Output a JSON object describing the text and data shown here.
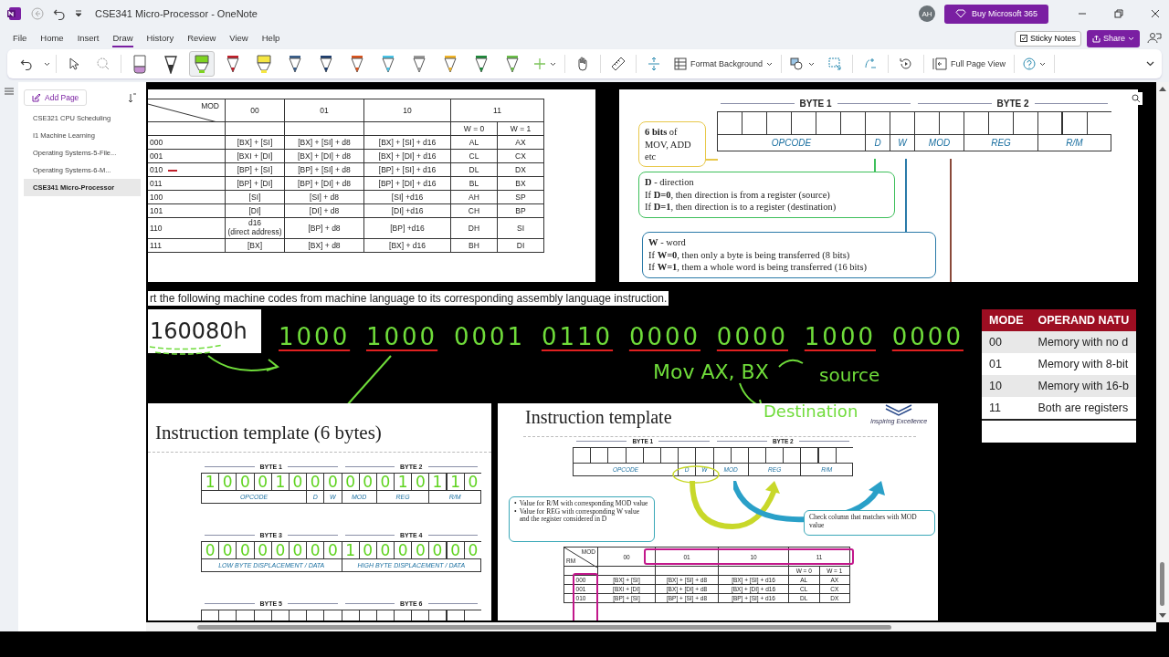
{
  "window": {
    "title": "CSE341 Micro-Processor - OneNote",
    "avatar": "AH",
    "buy_button": "Buy Microsoft 365"
  },
  "menu_tabs": [
    {
      "label": "File",
      "selected": false
    },
    {
      "label": "Home",
      "selected": false
    },
    {
      "label": "Insert",
      "selected": false
    },
    {
      "label": "Draw",
      "selected": true
    },
    {
      "label": "History",
      "selected": false
    },
    {
      "label": "Review",
      "selected": false
    },
    {
      "label": "View",
      "selected": false
    },
    {
      "label": "Help",
      "selected": false
    }
  ],
  "actions": {
    "sticky_notes": "Sticky Notes",
    "share": "Share"
  },
  "ribbon": {
    "pens": [
      {
        "kind": "eraser",
        "color": "#c58fd0",
        "selected": false
      },
      {
        "kind": "calligraphy",
        "color": "#333333",
        "selected": false
      },
      {
        "kind": "highlighter",
        "color": "#7ed321",
        "selected": true
      },
      {
        "kind": "pen",
        "color": "#c0202a",
        "selected": false
      },
      {
        "kind": "highlighter",
        "color": "#f5e642",
        "selected": false
      },
      {
        "kind": "pen",
        "color": "#3a5f8a",
        "selected": false
      },
      {
        "kind": "pen",
        "color": "#1f3f6f",
        "selected": false
      },
      {
        "kind": "pen",
        "color": "#d9541e",
        "selected": false
      },
      {
        "kind": "pen",
        "color": "#4ac3e6",
        "selected": false
      },
      {
        "kind": "pen",
        "color": "#9a9a9a",
        "selected": false
      },
      {
        "kind": "pen",
        "color": "#f0b429",
        "selected": false
      },
      {
        "kind": "pen",
        "color": "#1e8a3a",
        "selected": false
      },
      {
        "kind": "pen",
        "color": "#6cc04a",
        "selected": false
      }
    ],
    "format_background": "Format Background",
    "full_page_view": "Full Page View"
  },
  "sidebar": {
    "add_page": "Add Page",
    "pages": [
      {
        "title": "CSE321 CPU Scheduling",
        "selected": false
      },
      {
        "title": "I1 Machine Learning",
        "selected": false
      },
      {
        "title": "Operating Systems-5-File...",
        "selected": false
      },
      {
        "title": "Operating Systems-6-M...",
        "selected": false
      },
      {
        "title": "CSE341 Micro-Processor",
        "selected": true
      }
    ]
  },
  "page": {
    "addressing_table": {
      "mod_label": "MOD",
      "columns": [
        {
          "label": "00"
        },
        {
          "label": "01"
        },
        {
          "label": "10"
        },
        {
          "label": "11",
          "colspan": 2
        }
      ],
      "w_labels": [
        "W = 0",
        "W = 1"
      ],
      "rows": [
        {
          "rm": "000",
          "ink_mark": false,
          "cells": [
            "[BX] + [SI]",
            "[BX] + [SI] + d8",
            "[BX] + [SI] + d16",
            "AL",
            "AX"
          ]
        },
        {
          "rm": "001",
          "ink_mark": false,
          "cells": [
            "[BXI + [DI]",
            "[BX] + [DI] + d8",
            "[BX] + [DI] + d16",
            "CL",
            "CX"
          ]
        },
        {
          "rm": "010",
          "ink_mark": true,
          "cells": [
            "[BP] + [SI]",
            "[BP] + [SI] + d8",
            "[BP] + [SI] + d16",
            "DL",
            "DX"
          ]
        },
        {
          "rm": "011",
          "ink_mark": false,
          "cells": [
            "[BP] + [DI]",
            "[BP] + [DI] + d8",
            "[BP] + [DI] + d16",
            "BL",
            "BX"
          ]
        },
        {
          "rm": "100",
          "ink_mark": false,
          "cells": [
            "[SI]",
            "[SI] + d8",
            "[SI] +d16",
            "AH",
            "SP"
          ]
        },
        {
          "rm": "101",
          "ink_mark": false,
          "cells": [
            "[DI]",
            "[DI] + d8",
            "[DI] +d16",
            "CH",
            "BP"
          ]
        },
        {
          "rm": "110",
          "ink_mark": false,
          "cells": [
            "d16",
            "[BP] + d8",
            "[BP] +d16",
            "DH",
            "SI"
          ],
          "note": "(direct address)"
        },
        {
          "rm": "111",
          "ink_mark": false,
          "cells": [
            "[BX]",
            "[BX] + d8",
            "[BX] + d16",
            "BH",
            "DI"
          ]
        }
      ]
    },
    "format_diagram": {
      "bytes": [
        "BYTE 1",
        "BYTE 2"
      ],
      "fields": [
        {
          "label": "OPCODE",
          "kind": "opcode"
        },
        {
          "label": "D",
          "kind": "d"
        },
        {
          "label": "W",
          "kind": "w"
        },
        {
          "label": "MOD",
          "kind": "mod"
        },
        {
          "label": "REG",
          "kind": "reg"
        },
        {
          "label": "R/M",
          "kind": "rm"
        }
      ],
      "opcode_note": "**6 bits** of\nMOV, ADD etc",
      "d_note": [
        "**D** - direction",
        "If **D=0**, then direction is from a register (source)",
        "If **D=1**, then direction is to a register (destination)"
      ],
      "w_note": [
        "**W** - word",
        "If **W=0**, then only a byte is being transferred (8 bits)",
        "If **W=1**, them a whole word is being transferred (16 bits)"
      ]
    },
    "instruction_text": "rt the following machine codes from machine language to its corresponding assembly language instruction.",
    "hex_code": "160080h",
    "ink": {
      "bit_groups": [
        {
          "text": "1000",
          "struck": true
        },
        {
          "text": "1000",
          "struck": true
        },
        {
          "text": "0001",
          "struck": false
        },
        {
          "text": "0110",
          "struck": true
        },
        {
          "text": "0000",
          "struck": true
        },
        {
          "text": "0000",
          "struck": true
        },
        {
          "text": "1000",
          "struck": true
        },
        {
          "text": "0000",
          "struck": true
        }
      ],
      "mov": "Mov AX, BX",
      "source": "source",
      "destination": "Destination"
    },
    "template_6_bytes": {
      "title": "Instruction template (6 bytes)",
      "rows": [
        {
          "bytes": [
            "BYTE 1",
            "BYTE 2"
          ],
          "fields": [
            {
              "label": "OPCODE",
              "kind": "opcode"
            },
            {
              "label": "D",
              "kind": "d"
            },
            {
              "label": "W",
              "kind": "w"
            },
            {
              "label": "MOD",
              "kind": "mod"
            },
            {
              "label": "REG",
              "kind": "reg"
            },
            {
              "label": "R/M",
              "kind": "rm"
            }
          ],
          "bits": [
            "1",
            "0",
            "0",
            "0",
            "1",
            "0",
            "0",
            "0",
            "0",
            "0",
            "0",
            "1",
            "0",
            "1",
            "1",
            "0"
          ]
        },
        {
          "bytes": [
            "BYTE 3",
            "BYTE 4"
          ],
          "fields": [
            {
              "label": "LOW BYTE DISPLACEMENT / DATA",
              "kind": "byte"
            },
            {
              "label": "HIGH BYTE DISPLACEMENT / DATA",
              "kind": "byte"
            }
          ],
          "bits": [
            "0",
            "0",
            "0",
            "0",
            "0",
            "0",
            "0",
            "0",
            "1",
            "0",
            "0",
            "0",
            "0",
            "0",
            "0",
            "0"
          ]
        },
        {
          "bytes": [
            "BYTE 5",
            "BYTE 6"
          ]
        }
      ]
    },
    "template": {
      "title": "Instruction template",
      "logo_text": "Inspiring Excellence",
      "bytes": [
        "BYTE 1",
        "BYTE 2"
      ],
      "fields": [
        {
          "label": "OPCODE",
          "kind": "opcode"
        },
        {
          "label": "D",
          "kind": "d"
        },
        {
          "label": "W",
          "kind": "w"
        },
        {
          "label": "MOD",
          "kind": "mod"
        },
        {
          "label": "REG",
          "kind": "reg"
        },
        {
          "label": "R/M",
          "kind": "rm"
        }
      ],
      "left_note": [
        {
          "marker": "•",
          "text": "Value for R/M with corresponding MOD value"
        },
        {
          "marker": "•",
          "text": "Value for REG with corresponding W value and the register considered in D"
        }
      ],
      "right_note": "Check column that matches with MOD value",
      "table": {
        "rm_label": "RM",
        "mod_label": "MOD",
        "columns": [
          {
            "label": "00"
          },
          {
            "label": "01"
          },
          {
            "label": "10"
          },
          {
            "label": "11",
            "colspan": 2
          }
        ],
        "w_labels": [
          "W = 0",
          "W = 1"
        ],
        "rows": [
          {
            "rm": "000",
            "cells": [
              "[BX] + [SI]",
              "[BX] + [SI] + d8",
              "[BX] + [SI] + d16",
              "AL",
              "AX"
            ]
          },
          {
            "rm": "001",
            "cells": [
              "[BXI + [DI]",
              "[BX] + [DI] + d8",
              "[BX] + [DI] + d16",
              "CL",
              "CX"
            ]
          },
          {
            "rm": "010",
            "cells": [
              "[BP] + [SI]",
              "[BP] + [SI] + d8",
              "[BP] + [SI] + d16",
              "DL",
              "DX"
            ]
          }
        ]
      }
    },
    "mode_table": {
      "columns": [
        "MODE",
        "OPERAND NATU"
      ],
      "rows": [
        [
          "00",
          "Memory with no d"
        ],
        [
          "01",
          "Memory with 8-bit"
        ],
        [
          "10",
          "Memory with 16-b"
        ],
        [
          "11",
          "Both are registers"
        ]
      ]
    }
  }
}
